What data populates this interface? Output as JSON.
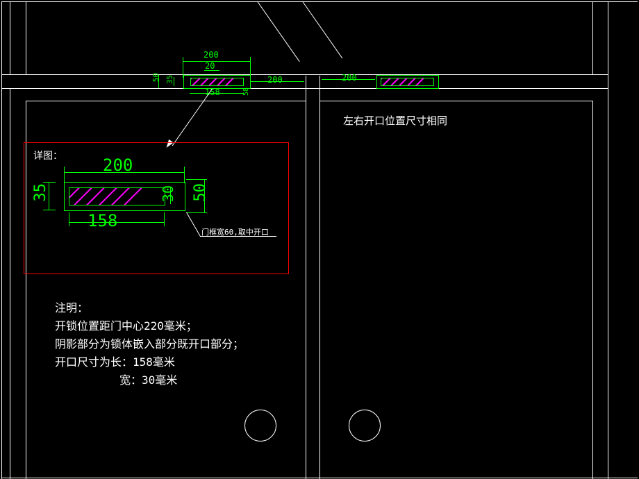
{
  "dims_top": {
    "w200": "200",
    "w20": "20",
    "d200a": "200",
    "d200b": "200",
    "h50": "50",
    "h35": "35",
    "w158": "158",
    "h58": "58"
  },
  "detail": {
    "label": "详图：",
    "w200": "200",
    "h35": "35",
    "h30": "30",
    "h50": "50",
    "w158": "158",
    "note": "门框宽60,取中开口"
  },
  "note_right": "左右开口位置尺寸相同",
  "notes": {
    "title": "注明：",
    "l1": "开锁位置距门中心220毫米；",
    "l2": "阴影部分为锁体嵌入部分既开口部分；",
    "l3": "开口尺寸为长：158毫米",
    "l4": "宽：30毫米"
  }
}
